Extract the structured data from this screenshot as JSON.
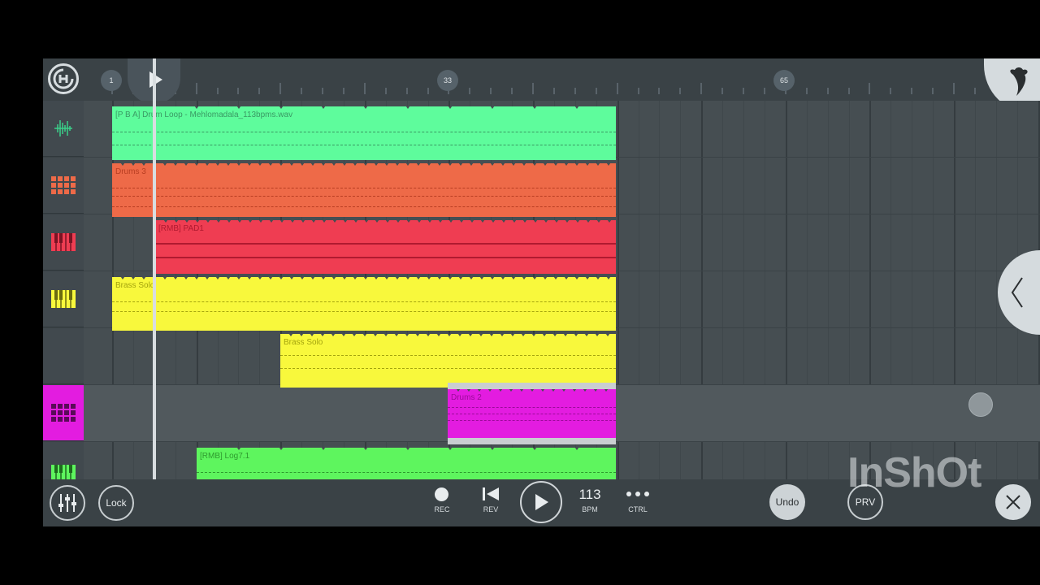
{
  "ruler": {
    "markers": [
      "1",
      "33",
      "65"
    ]
  },
  "tracks": [
    {
      "name": "[P B A] Drum Loop - Mehlomadala_113bpms.wav",
      "color": "#5efc9c",
      "text_color": "#3a9a64"
    },
    {
      "name": "Drums 3",
      "color": "#ee6a48",
      "text_color": "#b83e22"
    },
    {
      "name": "[RMB] PAD1",
      "color": "#ef3d52",
      "text_color": "#b01a30"
    },
    {
      "name": "Brass Solo",
      "color": "#f8f83c",
      "text_color": "#a4a40e"
    },
    {
      "name": "Brass Solo",
      "color": "#f8f83c",
      "text_color": "#a4a40e"
    },
    {
      "name": "Drums 2",
      "color": "#e31ce0",
      "text_color": "#9c0a9a"
    },
    {
      "name": "[RMB] Log7.1",
      "color": "#5ef55e",
      "text_color": "#2e9a2e"
    }
  ],
  "sidebar_icons": [
    "waveform-icon",
    "drum-pad-icon",
    "red-keys-icon",
    "yellow-keys-icon",
    "empty-slot",
    "magenta-drum-pad-icon",
    "green-keys-icon"
  ],
  "transport": {
    "lock": "Lock",
    "rec": "REC",
    "rev": "REV",
    "bpm_value": "113",
    "bpm_label": "BPM",
    "ctrl": "CTRL",
    "undo": "Undo",
    "prv": "PRV"
  },
  "watermark": "InShOt"
}
